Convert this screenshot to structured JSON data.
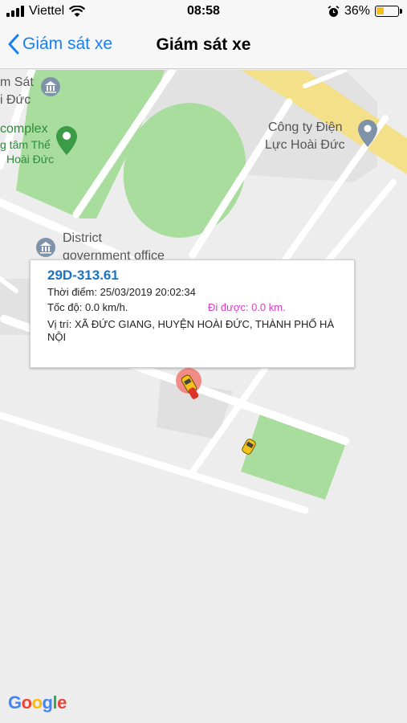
{
  "status_bar": {
    "carrier": "Viettel",
    "time": "08:58",
    "battery": "36%",
    "battery_level": 0.36,
    "icons": [
      "signal-bars-icon",
      "wifi-icon",
      "alarm-icon",
      "battery-icon"
    ]
  },
  "nav": {
    "back_label": "Giám sát xe",
    "title": "Giám sát xe",
    "accent_color": "#1a7ef5"
  },
  "map": {
    "labels": {
      "top_left_1": "m Sát",
      "top_left_2": "i Đức",
      "complex": "complex",
      "center_1": "g tâm Thể",
      "center_2": "Hoài Đức",
      "company_1": "Công ty Điện",
      "company_2": "Lực Hoài Đức",
      "district_1": "District",
      "district_2": "government office"
    },
    "google_logo": "Google"
  },
  "info_window": {
    "plate": "29D-313.61",
    "time_row": "Thời điểm: 25/03/2019 20:02:34",
    "speed_row": "Tốc độ: 0.0 km/h.",
    "distance_row": "Đi được: 0.0 km.",
    "location_row": "Vị trí: XÃ ĐỨC GIANG, HUYỆN HOÀI ĐỨC, THÀNH PHỐ HÀ NỘI"
  }
}
